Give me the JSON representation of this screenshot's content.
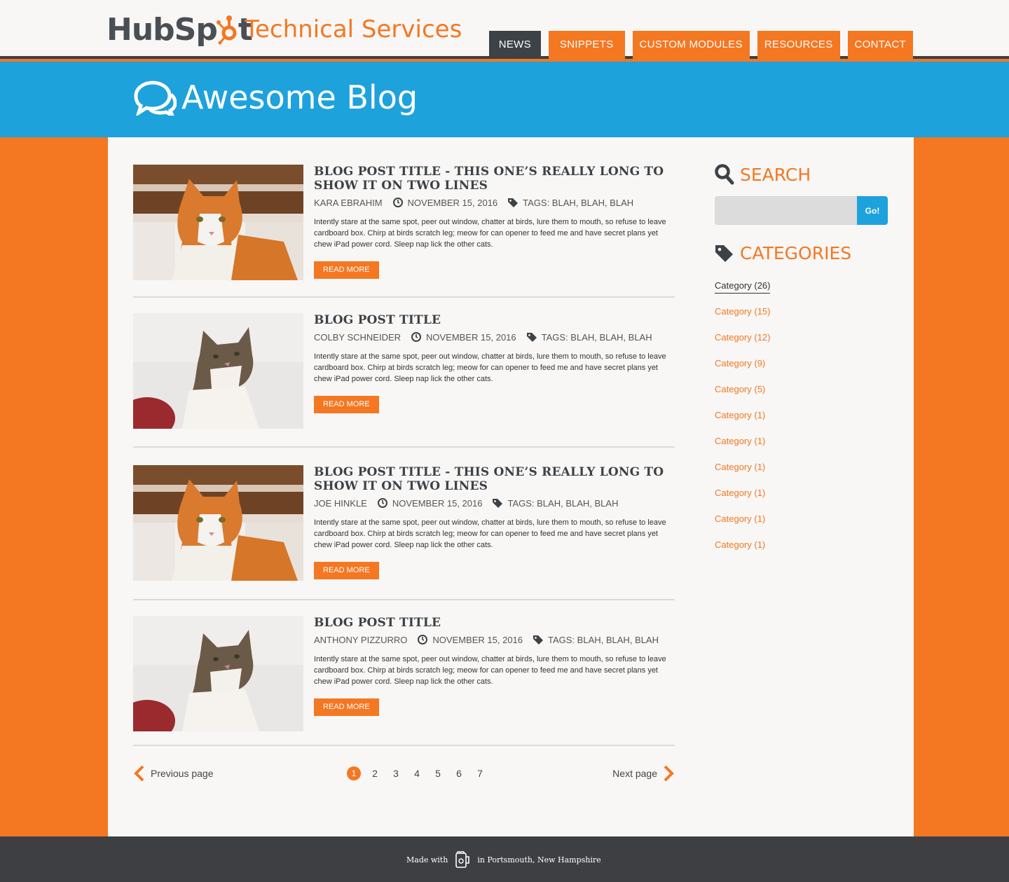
{
  "header": {
    "logo_text_hub": "HubSp",
    "logo_text_t": "t",
    "logo_subtitle": "Technical Services",
    "nav": [
      {
        "label": "NEWS"
      },
      {
        "label": "SNIPPETS"
      },
      {
        "label": "CUSTOM MODULES"
      },
      {
        "label": "RESOURCES"
      },
      {
        "label": "CONTACT"
      }
    ]
  },
  "banner": {
    "title": "Awesome Blog",
    "icon": "comments-icon"
  },
  "posts": [
    {
      "title": "Blog Post  Title - This one’s really long to show it on two lines",
      "author": "Kara Ebrahim",
      "date": "November 15, 2016",
      "tags": "Tags: Blah, Blah, Blah",
      "excerpt": "Intently stare at the same spot, peer out window, chatter at birds, lure them to mouth, so refuse to leave cardboard box. Chirp at birds scratch leg; meow for can opener to feed me and have secret plans yet chew iPad power cord. Sleep nap lick the other cats.",
      "read_more": "Read More",
      "image": "orange-cat"
    },
    {
      "title": "Blog Post Title",
      "author": "Colby Schneider",
      "date": "November 15, 2016",
      "tags": "Tags: Blah, Blah, Blah",
      "excerpt": "Intently stare at the same spot, peer out window, chatter at birds, lure them to mouth, so refuse to leave cardboard box. Chirp at birds scratch leg; meow for can opener to feed me and have secret plans yet chew iPad power cord. Sleep nap lick the other cats.",
      "read_more": "Read More",
      "image": "tabby-cat"
    },
    {
      "title": "Blog Post Title - This one’s really long to show it on two lines",
      "author": "Joe Hinkle",
      "date": "November 15, 2016",
      "tags": "Tags: Blah, Blah, Blah",
      "excerpt": "Intently stare at the same spot, peer out window, chatter at birds, lure them to mouth, so refuse to leave cardboard box. Chirp at birds scratch leg; meow for can opener to feed me and have secret plans yet chew iPad power cord. Sleep nap lick the other cats.",
      "read_more": "Read More",
      "image": "orange-cat"
    },
    {
      "title": "Blog Post Title",
      "author": "Anthony Pizzurro",
      "date": "November 15, 2016",
      "tags": "Tags: Blah, Blah, Blah",
      "excerpt": "Intently stare at the same spot, peer out window, chatter at birds, lure them to mouth, so refuse to leave cardboard box. Chirp at birds scratch leg; meow for can opener to feed me and have secret plans yet chew iPad power cord. Sleep nap lick the other cats.",
      "read_more": "Read More",
      "image": "tabby-cat"
    }
  ],
  "pagination": {
    "prev": "Previous page",
    "next": "Next page",
    "pages": [
      "1",
      "2",
      "3",
      "4",
      "5",
      "6",
      "7"
    ],
    "current": "1"
  },
  "sidebar": {
    "search_heading": "Search",
    "search_button": "Go!",
    "search_placeholder": "",
    "categories_heading": "Categories",
    "categories": [
      "Category (26)",
      "Category (15)",
      "Category (12)",
      "Category (9)",
      "Category (5)",
      "Category (1)",
      "Category (1)",
      "Category (1)",
      "Category (1)",
      "Category (1)",
      "Category (1)"
    ]
  },
  "footer": {
    "made_with": "Made with",
    "location": "in Portsmouth, New Hampshire"
  },
  "colors": {
    "orange": "#f47722",
    "blue": "#1ea2dc",
    "dark": "#3d4247",
    "light_bg": "#f8f7f5"
  }
}
